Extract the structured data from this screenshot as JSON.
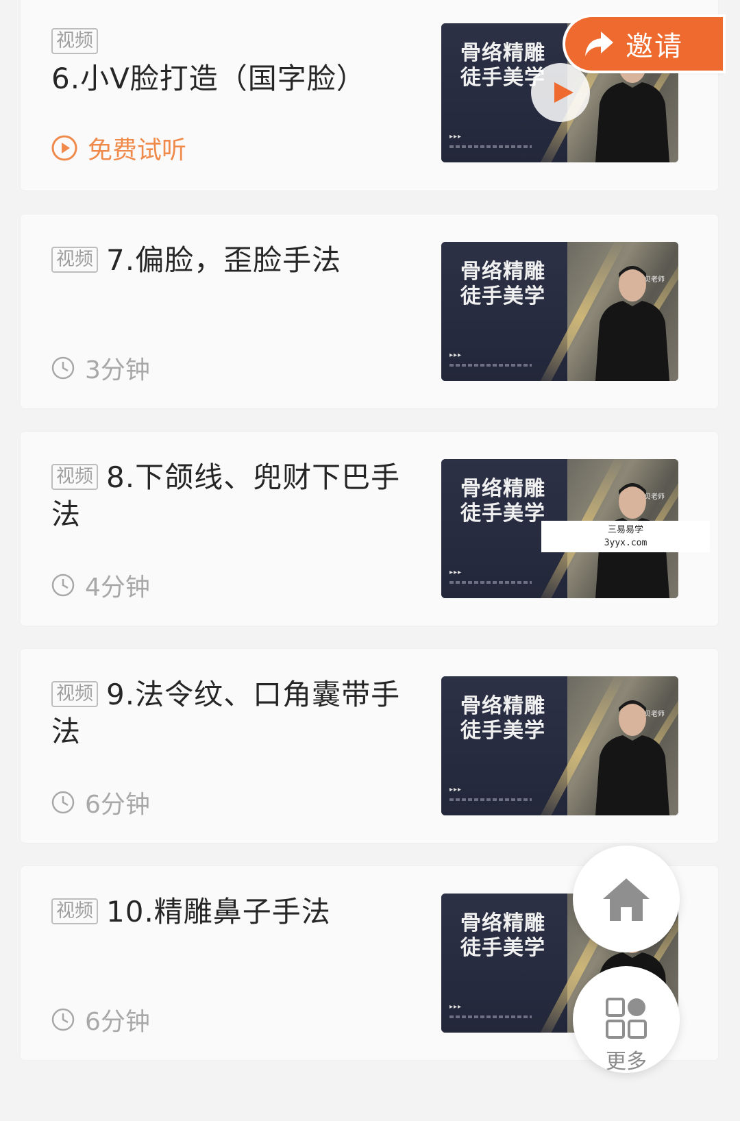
{
  "lessons": [
    {
      "badge": "视频",
      "title": "6.小V脸打造（国字脸）",
      "meta": "免费试听",
      "meta_type": "free-trial",
      "thumb_title_line1": "骨络精雕",
      "thumb_title_line2": "徒手美学",
      "thumb_teacher": "",
      "playing": true
    },
    {
      "badge": "视频",
      "title": "7.偏脸，歪脸手法",
      "meta": "3分钟",
      "meta_type": "duration",
      "thumb_title_line1": "骨络精雕",
      "thumb_title_line2": "徒手美学",
      "thumb_teacher": "贝贝老师",
      "playing": false
    },
    {
      "badge": "视频",
      "title": "8.下颌线、兜财下巴手法",
      "meta": "4分钟",
      "meta_type": "duration",
      "thumb_title_line1": "骨络精雕",
      "thumb_title_line2": "徒手美学",
      "thumb_teacher": "贝贝老师",
      "playing": false
    },
    {
      "badge": "视频",
      "title": "9.法令纹、口角囊带手法",
      "meta": "6分钟",
      "meta_type": "duration",
      "thumb_title_line1": "骨络精雕",
      "thumb_title_line2": "徒手美学",
      "thumb_teacher": "贝贝老师",
      "playing": false
    },
    {
      "badge": "视频",
      "title": "10.精雕鼻子手法",
      "meta": "6分钟",
      "meta_type": "duration",
      "thumb_title_line1": "骨络精雕",
      "thumb_title_line2": "徒手美学",
      "thumb_teacher": "",
      "playing": false
    }
  ],
  "invite_button": {
    "label": "邀请",
    "icon": "share-arrow-icon",
    "color": "#ef6a2e"
  },
  "watermark": {
    "line1": "三易易学",
    "line2": "3yyx.com"
  },
  "home_button": {
    "icon": "home-icon"
  },
  "more_button": {
    "label": "更多",
    "icon": "grid-icon"
  },
  "colors": {
    "accent": "#f08a4b",
    "muted": "#a8a8a8",
    "badge_border": "#bdbdbd"
  }
}
